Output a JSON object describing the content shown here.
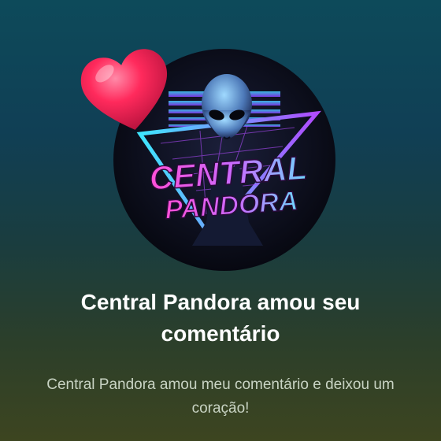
{
  "notification": {
    "avatar": {
      "logo_line1": "CENTRAL",
      "logo_line2": "PANDORA"
    },
    "reaction_icon": "heart-icon",
    "title": "Central Pandora amou seu comentário",
    "message": "Central Pandora amou meu comentário e deixou um coração!"
  },
  "colors": {
    "heart": "#ff2a5c",
    "title": "#ffffff",
    "message": "#c9d4c4",
    "logo_pink": "#ff4fd8",
    "logo_cyan": "#3ee6ff"
  }
}
